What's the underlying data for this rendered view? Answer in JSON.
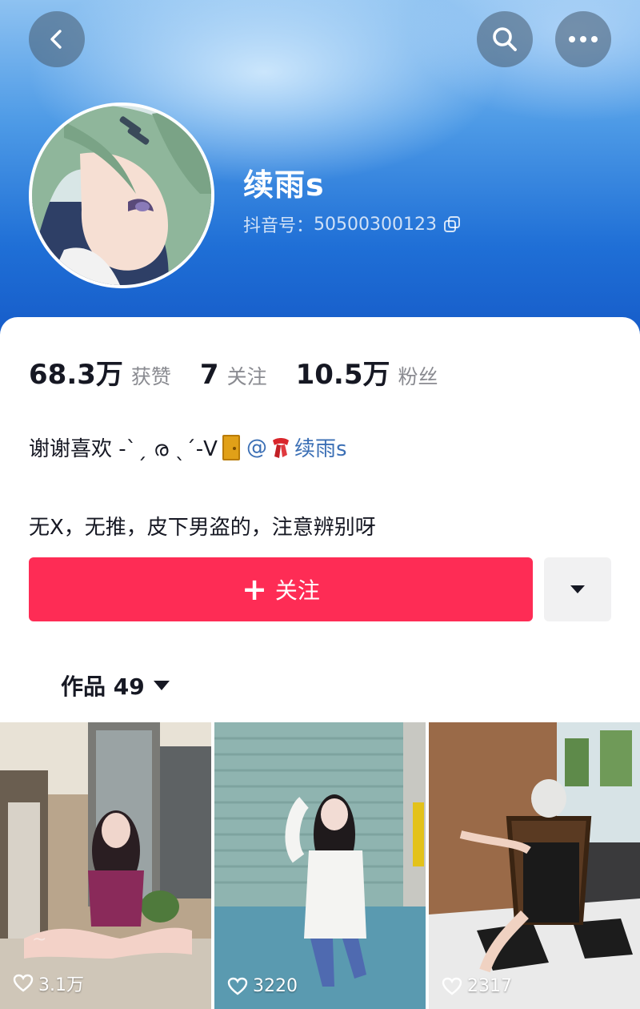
{
  "header": {
    "name": "续雨s",
    "douyin_id_label": "抖音号：",
    "douyin_id": "50500300123"
  },
  "stats": [
    {
      "value": "68.3万",
      "label": "获赞"
    },
    {
      "value": "7",
      "label": "关注"
    },
    {
      "value": "10.5万",
      "label": "粉丝"
    }
  ],
  "bio": {
    "line1_prefix": "谢谢喜欢 -ˋˏ ര ˎˊ-V",
    "line1_at": "@",
    "line1_link": "续雨s",
    "line2": "无X，无推，皮下男盗的，注意辨别呀"
  },
  "actions": {
    "follow_label": "关注"
  },
  "tabs": {
    "works_label": "作品 49"
  },
  "videos": [
    {
      "likes": "3.1万"
    },
    {
      "likes": "3220"
    },
    {
      "likes": "2317"
    }
  ],
  "colors": {
    "accent": "#fe2c55",
    "link": "#3b6fb5",
    "header_blue": "#1f6fd6"
  }
}
